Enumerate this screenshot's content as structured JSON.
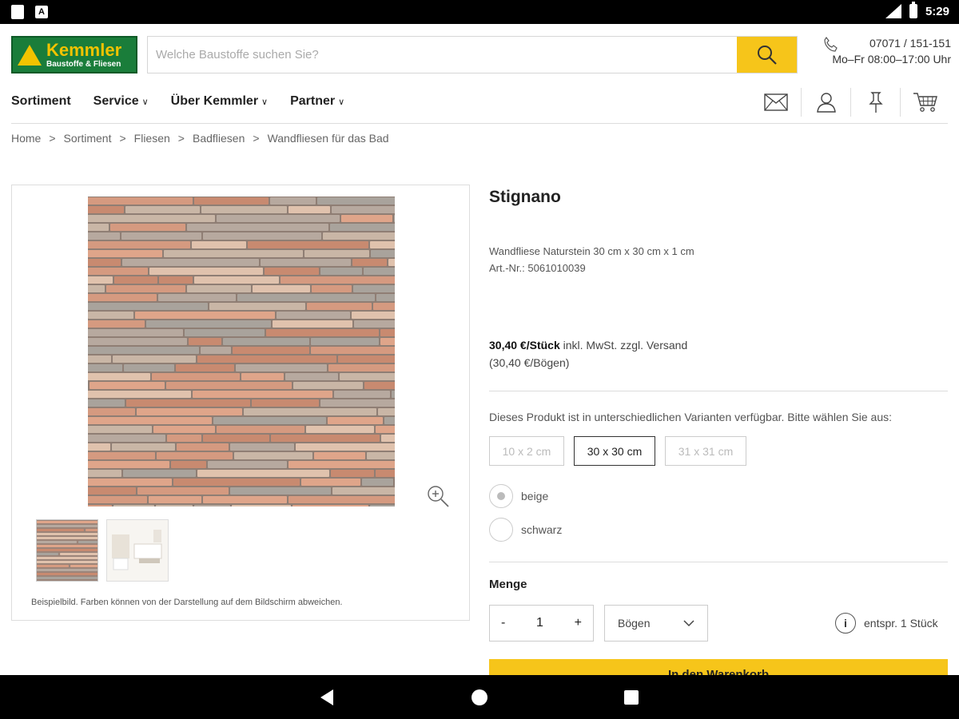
{
  "status_bar": {
    "time": "5:29"
  },
  "header": {
    "logo_line1": "Kemmler",
    "logo_line2": "Baustoffe & Fliesen",
    "search_placeholder": "Welche Baustoffe suchen Sie?",
    "phone": "07071 / 151-151",
    "hours": "Mo–Fr 08:00–17:00 Uhr"
  },
  "nav": {
    "items": [
      {
        "label": "Sortiment",
        "chevron": ""
      },
      {
        "label": "Service",
        "chevron": "∨"
      },
      {
        "label": "Über Kemmler",
        "chevron": "∨"
      },
      {
        "label": "Partner",
        "chevron": "∨"
      }
    ],
    "icons": [
      "mail-icon",
      "user-icon",
      "pin-icon",
      "cart-icon"
    ]
  },
  "breadcrumb": {
    "items": [
      "Home",
      "Sortiment",
      "Fliesen",
      "Badfliesen",
      "Wandfliesen für das Bad"
    ],
    "separator": ">"
  },
  "gallery": {
    "caption": "Beispielbild. Farben können von der Darstellung auf dem Bildschirm abweichen."
  },
  "product": {
    "title": "Stignano",
    "description": "Wandfliese Naturstein 30 cm x 30 cm x 1 cm",
    "article_no": "Art.-Nr.: 5061010039",
    "price": "30,40 €/Stück",
    "price_suffix": " inkl. MwSt. zzgl. Versand",
    "price_per_sheet": "(30,40 €/Bögen)",
    "variants_text": "Dieses Produkt ist in unterschiedlichen Varianten verfügbar. Bitte wählen Sie aus:",
    "sizes": [
      "10 x 2 cm",
      "30 x 30 cm",
      "31 x 31 cm"
    ],
    "selected_size": "30 x 30 cm",
    "colors": [
      "beige",
      "schwarz"
    ],
    "selected_color": "beige",
    "quantity_label": "Menge",
    "quantity_minus": "-",
    "quantity_value": "1",
    "quantity_plus": "+",
    "unit": "Bögen",
    "info_symbol": "i",
    "equivalent": "entspr. 1 Stück",
    "cart_button": "In den Warenkorb"
  },
  "colors": {
    "accent_yellow": "#f6c51a",
    "brand_green": "#1a7d3a"
  }
}
